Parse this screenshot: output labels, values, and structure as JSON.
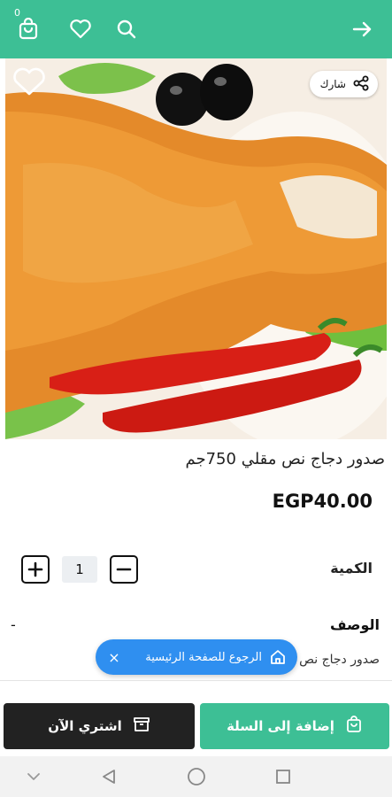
{
  "header": {
    "cart_count": "0",
    "icons": [
      "cart-icon",
      "heart-icon",
      "search-icon",
      "arrow-right-icon"
    ],
    "background_color": "#3dbf95"
  },
  "hero": {
    "share_label": "شارك"
  },
  "product": {
    "title": "صدور دجاج نص مقلي 750جم",
    "price": "EGP40.00"
  },
  "quantity": {
    "label": "الكمية",
    "value": "1"
  },
  "description": {
    "label": "الوصف",
    "dash": "-",
    "text": "صدور دجاج نص"
  },
  "toast": {
    "text": "الرجوع للصفحة الرئيسية",
    "close": "×",
    "color": "#2f8ff0"
  },
  "actions": {
    "add_to_cart": "إضافة إلى السلة",
    "buy_now": "اشتري الآن",
    "add_color": "#3dbf95",
    "buy_color": "#222222"
  },
  "system_nav": {
    "icons": [
      "chevron-down-icon",
      "back-icon",
      "home-circle-icon",
      "recents-icon"
    ]
  }
}
